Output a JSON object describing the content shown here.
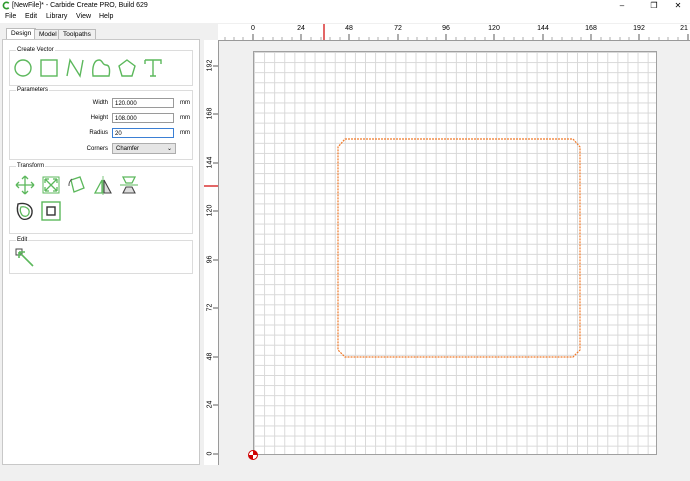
{
  "window": {
    "title": "[NewFile]* - Carbide Create PRO, Build 629",
    "minimize": "–",
    "restore": "❐",
    "close": "✕"
  },
  "menu": {
    "file": "File",
    "edit": "Edit",
    "library": "Library",
    "view": "View",
    "help": "Help"
  },
  "tabs": [
    "Design",
    "Model",
    "Toolpaths"
  ],
  "active_tab": "Design",
  "create_vector": {
    "title": "Create Vector",
    "tools": [
      "circle-icon",
      "rectangle-icon",
      "polyline-icon",
      "curve-icon",
      "polygon-icon",
      "text-icon"
    ]
  },
  "parameters": {
    "title": "Parameters",
    "width_label": "Width",
    "width_value": "120.000",
    "height_label": "Height",
    "height_value": "108.000",
    "radius_label": "Radius",
    "radius_value": "20",
    "corners_label": "Corners",
    "corners_value": "Chamfer",
    "unit": "mm"
  },
  "transform": {
    "title": "Transform",
    "tools": [
      "move-icon",
      "scale-icon",
      "rotate-icon",
      "mirror-icon",
      "align-icon",
      "offset-icon",
      "boundary-box-icon"
    ]
  },
  "edit": {
    "title": "Edit",
    "tools": [
      "node-edit-icon"
    ]
  },
  "ruler": {
    "x_labels": [
      "0",
      "24",
      "48",
      "72",
      "96",
      "120",
      "144",
      "168",
      "192",
      "21"
    ],
    "y_labels": [
      "192",
      "168",
      "144",
      "120",
      "96",
      "72",
      "48",
      "24",
      "0"
    ]
  },
  "colors": {
    "accent_green": "#5cb85c",
    "shape_orange": "#f07a2a",
    "ruler_marker": "#d00000"
  }
}
